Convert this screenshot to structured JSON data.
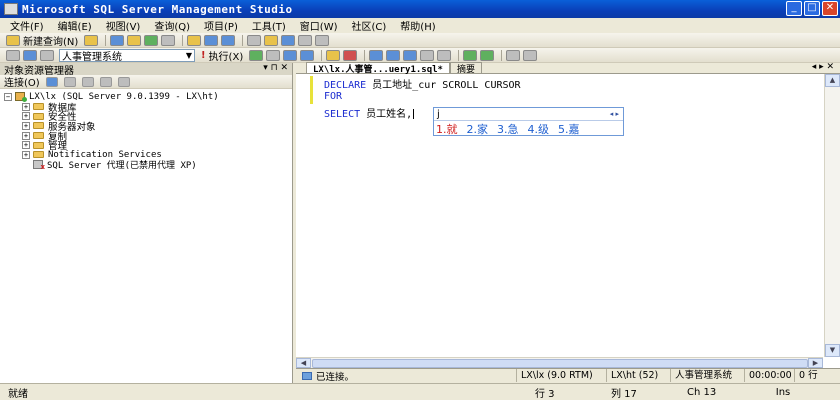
{
  "window": {
    "title": "Microsoft SQL Server Management Studio",
    "min_glyph": "_",
    "max_glyph": "□",
    "close_glyph": "✕"
  },
  "menu": [
    "文件(F)",
    "编辑(E)",
    "视图(V)",
    "查询(Q)",
    "项目(P)",
    "工具(T)",
    "窗口(W)",
    "社区(C)",
    "帮助(H)"
  ],
  "toolbar1": {
    "new_query_label": "新建查询(N)"
  },
  "toolbar2": {
    "database_select": "人事管理系统",
    "execute_label": "执行(X)"
  },
  "object_explorer": {
    "title": "对象资源管理器",
    "connect_label": "连接(O)",
    "header_controls": "▾ ⊓ ✕",
    "server_node": "LX\\lx (SQL Server 9.0.1399 - LX\\ht)",
    "folders": [
      "数据库",
      "安全性",
      "服务器对象",
      "复制",
      "管理",
      "Notification Services"
    ],
    "agent_node": "SQL Server 代理(已禁用代理 XP)"
  },
  "editor": {
    "tab_active": "LX\\lx.人事管...uery1.sql*",
    "tab_summary": "摘要",
    "tab_controls": "◂ ▸ ✕",
    "lines": [
      {
        "kw": "DECLARE",
        "text": " 员工地址_cur SCROLL CURSOR"
      },
      {
        "kw": "FOR",
        "text": ""
      },
      {
        "kw": "SELECT",
        "text": " 员工姓名,"
      }
    ]
  },
  "ime": {
    "composition": "j",
    "nav": "◂ ▸",
    "candidates": [
      "1.就",
      "2.家",
      "3.急",
      "4.级",
      "5.嘉"
    ]
  },
  "editor_status": {
    "connection": "已连接。",
    "server": "LX\\lx (9.0 RTM)",
    "user": "LX\\ht (52)",
    "database": "人事管理系统",
    "time": "00:00:00",
    "rows": "0 行"
  },
  "status_bar": {
    "ready": "就绪",
    "line": "行 3",
    "col": "列 17",
    "ch": "Ch 13",
    "ins": "Ins"
  }
}
